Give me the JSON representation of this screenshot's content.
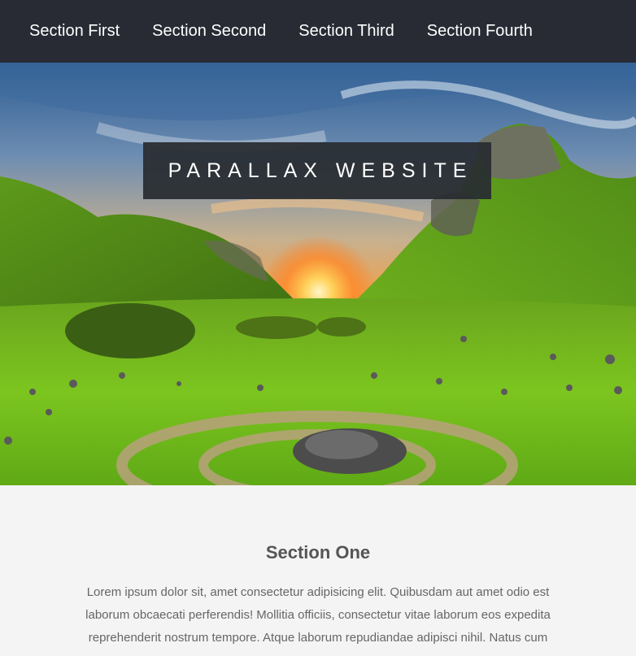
{
  "nav": {
    "items": [
      {
        "label": "Section First"
      },
      {
        "label": "Section Second"
      },
      {
        "label": "Section Third"
      },
      {
        "label": "Section Fourth"
      }
    ]
  },
  "hero": {
    "title": "PARALLAX WEBSITE",
    "image_description_icon": "landscape-image"
  },
  "section_one": {
    "heading": "Section One",
    "text": "Lorem ipsum dolor sit, amet consectetur adipisicing elit. Quibusdam aut amet odio est laborum obcaecati perferendis! Mollitia officiis, consectetur vitae laborum eos expedita reprehenderit nostrum tempore. Atque laborum repudiandae adipisci nihil. Natus cum"
  },
  "colors": {
    "navbar": "#282b34",
    "title_box": "#282c30",
    "background": "#f4f4f4",
    "heading": "#555555",
    "text": "#666666"
  }
}
